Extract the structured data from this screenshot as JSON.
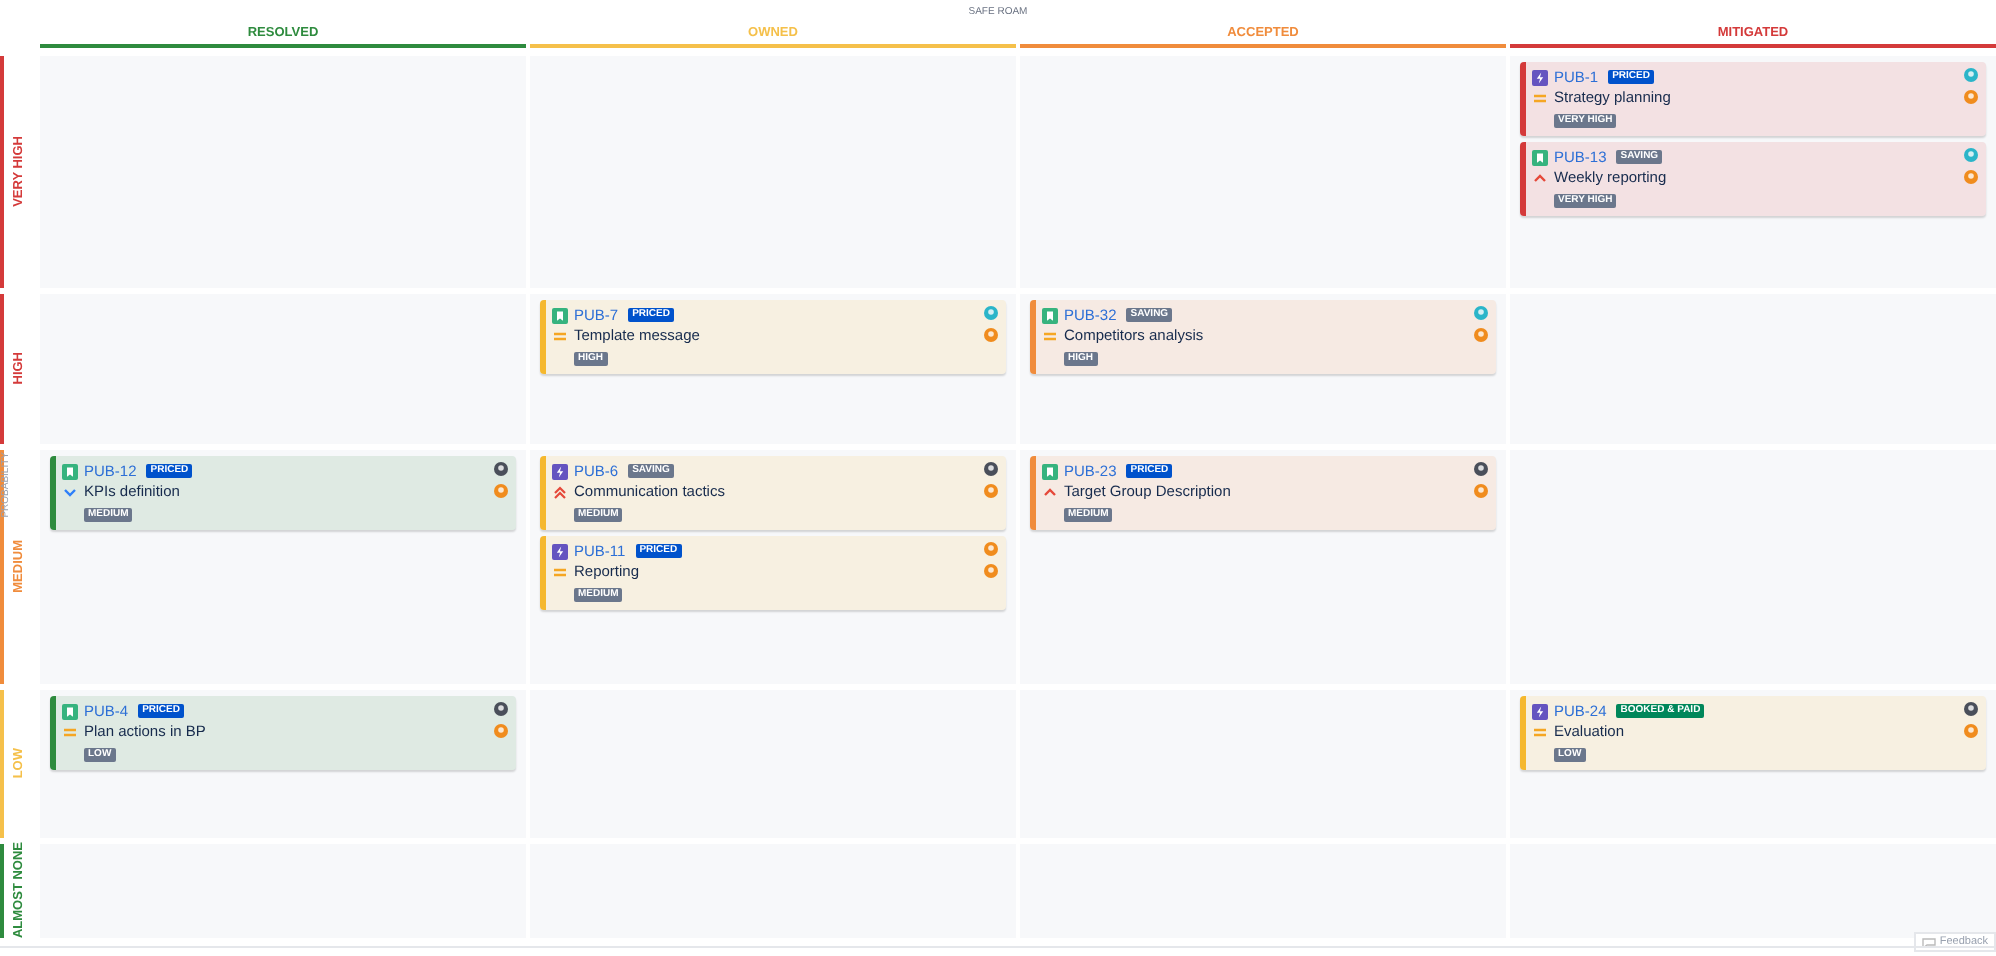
{
  "title": "SAFE ROAM",
  "axis_label": "PROBABILITY",
  "columns": [
    {
      "label": "RESOLVED",
      "color": "#2e8b3e"
    },
    {
      "label": "OWNED",
      "color": "#f5c04a"
    },
    {
      "label": "ACCEPTED",
      "color": "#f08c3c"
    },
    {
      "label": "MITIGATED",
      "color": "#d43a3a"
    }
  ],
  "rows": [
    {
      "label": "VERY HIGH",
      "color": "#d43a3a",
      "cells": [
        [],
        [],
        [],
        [
          {
            "key": "PUB-1",
            "kind": "task",
            "status": {
              "label": "PRICED",
              "kind": "blue"
            },
            "priority": {
              "kind": "medium"
            },
            "title": "Strategy planning",
            "risk": "VERY HIGH",
            "color": "#d43a3a",
            "avatars": [
              {
                "color": "#2bb5c9"
              },
              {
                "color": "#f08c1e"
              }
            ]
          },
          {
            "key": "PUB-13",
            "kind": "story",
            "status": {
              "label": "SAVING",
              "kind": "grey"
            },
            "priority": {
              "kind": "high"
            },
            "title": "Weekly reporting",
            "risk": "VERY HIGH",
            "color": "#d43a3a",
            "avatars": [
              {
                "color": "#2bb5c9"
              },
              {
                "color": "#f08c1e"
              }
            ]
          }
        ]
      ]
    },
    {
      "label": "HIGH",
      "color": "#d43a3a",
      "cells": [
        [],
        [
          {
            "key": "PUB-7",
            "kind": "story",
            "status": {
              "label": "PRICED",
              "kind": "blue"
            },
            "priority": {
              "kind": "medium"
            },
            "title": "Template message",
            "risk": "HIGH",
            "color": "#f5b82e",
            "avatars": [
              {
                "color": "#2bb5c9"
              },
              {
                "color": "#f08c1e"
              }
            ]
          }
        ],
        [
          {
            "key": "PUB-32",
            "kind": "story",
            "status": {
              "label": "SAVING",
              "kind": "grey"
            },
            "priority": {
              "kind": "medium"
            },
            "title": "Competitors analysis",
            "risk": "HIGH",
            "color": "#f08c3c",
            "avatars": [
              {
                "color": "#2bb5c9"
              },
              {
                "color": "#f08c1e"
              }
            ]
          }
        ],
        []
      ]
    },
    {
      "label": "MEDIUM",
      "color": "#f08c3c",
      "cells": [
        [
          {
            "key": "PUB-12",
            "kind": "story",
            "status": {
              "label": "PRICED",
              "kind": "blue"
            },
            "priority": {
              "kind": "low"
            },
            "title": "KPIs definition",
            "risk": "MEDIUM",
            "color": "#2e8b3e",
            "avatars": [
              {
                "color": "#4a4f5a"
              },
              {
                "color": "#f08c1e"
              }
            ]
          }
        ],
        [
          {
            "key": "PUB-6",
            "kind": "task",
            "status": {
              "label": "SAVING",
              "kind": "grey"
            },
            "priority": {
              "kind": "highest"
            },
            "title": "Communication tactics",
            "risk": "MEDIUM",
            "color": "#f5b82e",
            "avatars": [
              {
                "color": "#4a4f5a"
              },
              {
                "color": "#f08c1e"
              }
            ]
          },
          {
            "key": "PUB-11",
            "kind": "task",
            "status": {
              "label": "PRICED",
              "kind": "blue"
            },
            "priority": {
              "kind": "medium"
            },
            "title": "Reporting",
            "risk": "MEDIUM",
            "color": "#f5b82e",
            "avatars": [
              {
                "color": "#f08c1e"
              },
              {
                "color": "#f08c1e"
              }
            ]
          }
        ],
        [
          {
            "key": "PUB-23",
            "kind": "story",
            "status": {
              "label": "PRICED",
              "kind": "blue"
            },
            "priority": {
              "kind": "high"
            },
            "title": "Target Group Description",
            "risk": "MEDIUM",
            "color": "#f08c3c",
            "avatars": [
              {
                "color": "#4a4f5a"
              },
              {
                "color": "#f08c1e"
              }
            ]
          }
        ],
        []
      ]
    },
    {
      "label": "LOW",
      "color": "#f5c04a",
      "cells": [
        [
          {
            "key": "PUB-4",
            "kind": "story",
            "status": {
              "label": "PRICED",
              "kind": "blue"
            },
            "priority": {
              "kind": "medium"
            },
            "title": "Plan actions in BP",
            "risk": "LOW",
            "color": "#2e8b3e",
            "avatars": [
              {
                "color": "#4a4f5a"
              },
              {
                "color": "#f08c1e"
              }
            ]
          }
        ],
        [],
        [],
        [
          {
            "key": "PUB-24",
            "kind": "task",
            "status": {
              "label": "BOOKED & PAID",
              "kind": "green"
            },
            "priority": {
              "kind": "medium"
            },
            "title": "Evaluation",
            "risk": "LOW",
            "color": "#f5b82e",
            "avatars": [
              {
                "color": "#4a4f5a"
              },
              {
                "color": "#f08c1e"
              }
            ]
          }
        ]
      ]
    },
    {
      "label": "ALMOST NONE",
      "color": "#2e8b3e",
      "cells": [
        [],
        [],
        [],
        []
      ]
    }
  ],
  "feedback": "Feedback"
}
